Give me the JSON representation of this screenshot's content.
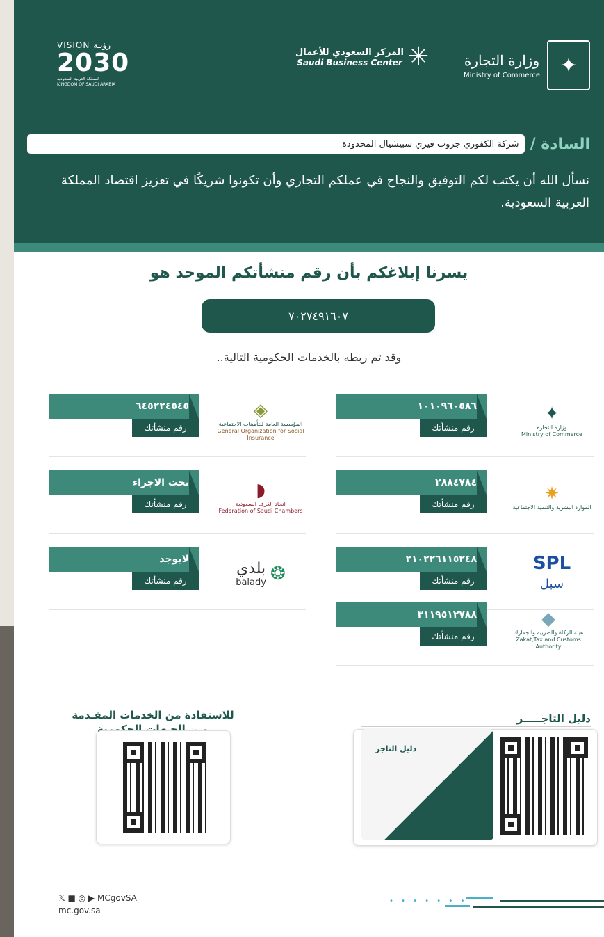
{
  "header": {
    "ministry_ar": "وزارة التجارة",
    "ministry_en": "Ministry of Commerce",
    "sbc_ar": "المركز السعودي للأعمال",
    "sbc_en": "Saudi Business Center",
    "vision_top": "VISION رؤيـة",
    "vision_num": "2030",
    "vision_sub_ar": "المملكة العربية السعودية",
    "vision_sub_en": "KINGDOM OF SAUDI ARABIA",
    "to_label": "السادة /",
    "company_name": "شركة الكفوري جروب فيري سبيشيال المحدودة",
    "wish": "نسأل الله أن يكتب لكم التوفيق والنجاح في عملكم التجاري وأن تكونوا شريكًا في تعزيز اقتصاد المملكة العربية السعودية."
  },
  "main": {
    "title": "يسرنا إبلاغكم بأن رقم منشأتكم الموحد هو",
    "unified_number": "٧٠٢٧٤٩١٦٠٧",
    "linked_text": "وقد تم ربطه بالخدمات الحكومية التالية.."
  },
  "services": [
    {
      "name_ar": "وزارة التجارة",
      "name_en": "Ministry of Commerce",
      "number": "١٠١٠٩٦٠٥٨٦",
      "label": "رقم منشأتك"
    },
    {
      "name_ar": "المؤسسة العامة للتأمينات الاجتماعية",
      "name_en": "General Organization for Social Insurance",
      "number": "٦٤٥٢٢٤٥٤٥",
      "label": "رقم منشأتك"
    },
    {
      "name_ar": "الموارد البشرية والتنمية الاجتماعية",
      "name_en": "",
      "number": "٢٨٨٤٧٨٤",
      "label": "رقم منشأتك"
    },
    {
      "name_ar": "اتحاد الغرف السعودية",
      "name_en": "Federation of Saudi Chambers",
      "number": "تحت الاجراء",
      "label": "رقم منشأتك"
    },
    {
      "name_ar": "سبل",
      "name_en": "SPL",
      "number": "٢١٠٢٢٦١١٥٢٤٨",
      "label": "رقم منشأتك"
    },
    {
      "name_ar": "بلدي",
      "name_en": "balady",
      "number": "لايوجد",
      "label": "رقم منشأتك"
    },
    {
      "name_ar": "هيئة الزكاة والضريبة والجمارك",
      "name_en": "Zakat,Tax and Customs Authority",
      "number": "٣١١٩٥١٢٧٨٨",
      "label": "رقم منشأتك"
    }
  ],
  "qr_left": {
    "title_line1": "للاستفادة من الخدمات المقـدمة",
    "title_line2": "مـن الجـهات الحكومية"
  },
  "qr_right": {
    "title": "دليل التاجـــــر",
    "book_title": "دليل التاجر"
  },
  "footer": {
    "social": "MCgovSA",
    "url": "mc.gov.sa"
  }
}
